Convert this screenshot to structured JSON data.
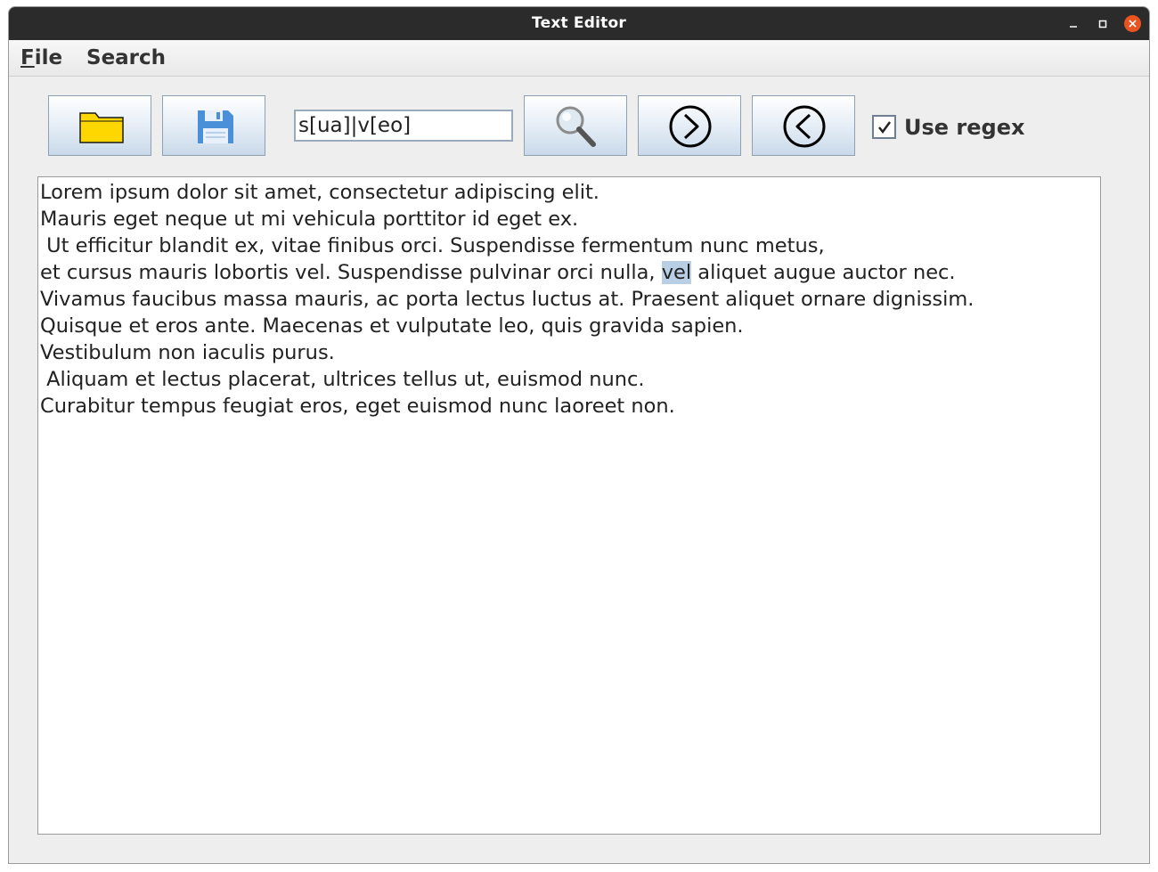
{
  "window": {
    "title": "Text Editor"
  },
  "menu": {
    "file": {
      "mnemonic": "F",
      "rest": "ile"
    },
    "search": "Search"
  },
  "toolbar": {
    "open_icon": "folder-icon",
    "save_icon": "floppy-disk-icon",
    "search_value": "s[ua]|v[eo]",
    "find_icon": "magnifier-icon",
    "next_icon": "circled-right-arrow-icon",
    "prev_icon": "circled-left-arrow-icon",
    "use_regex": {
      "label": "Use regex",
      "checked": true
    }
  },
  "editor": {
    "lines": [
      "Lorem ipsum dolor sit amet, consectetur adipiscing elit.",
      "Mauris eget neque ut mi vehicula porttitor id eget ex.",
      " Ut efficitur blandit ex, vitae finibus orci. Suspendisse fermentum nunc metus,",
      {
        "before": "et cursus mauris lobortis vel. Suspendisse pulvinar orci nulla, ",
        "match": "vel",
        "after": " aliquet augue auctor nec."
      },
      "Vivamus faucibus massa mauris, ac porta lectus luctus at. Praesent aliquet ornare dignissim.",
      "Quisque et eros ante. Maecenas et vulputate leo, quis gravida sapien.",
      "Vestibulum non iaculis purus.",
      " Aliquam et lectus placerat, ultrices tellus ut, euismod nunc.",
      "Curabitur tempus feugiat eros, eget euismod nunc laoreet non."
    ]
  },
  "colors": {
    "titlebar": "#2b2b2b",
    "close_button": "#e95420",
    "selection": "#b8cfe5",
    "folder": "#ffd700",
    "floppy": "#4a90d9"
  }
}
